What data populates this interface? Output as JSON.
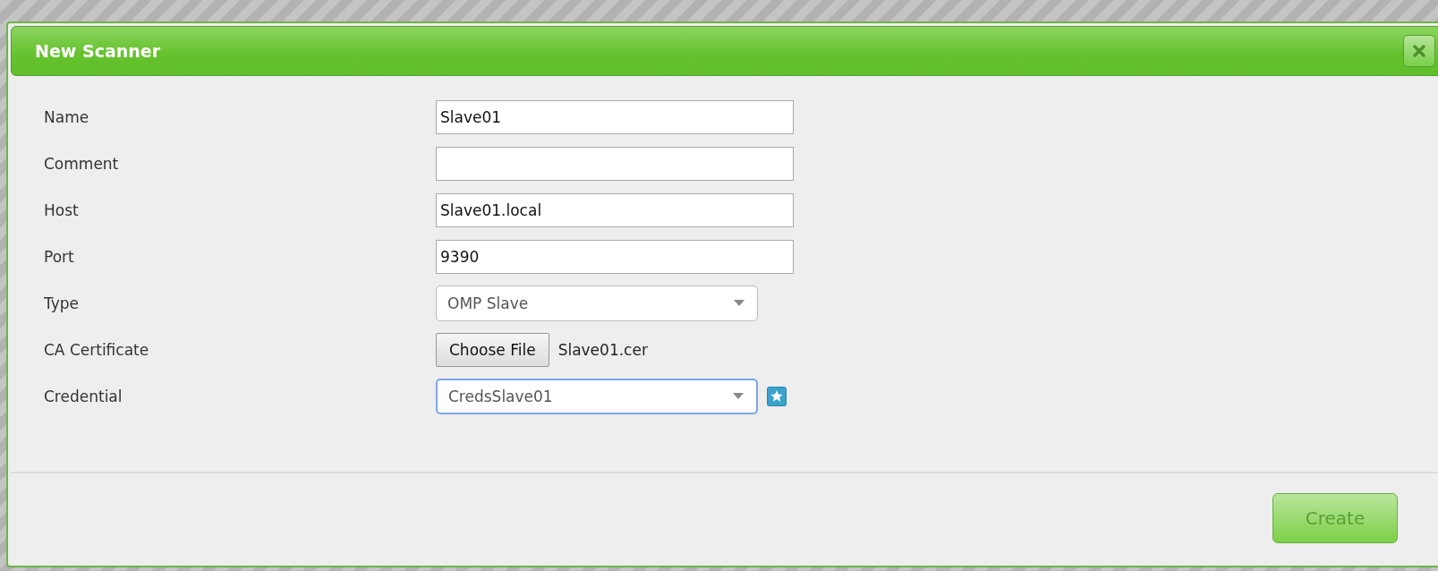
{
  "dialog": {
    "title": "New Scanner"
  },
  "fields": [
    {
      "label": "Name",
      "kind": "text",
      "value": "Slave01"
    },
    {
      "label": "Comment",
      "kind": "text"
    },
    {
      "label": "Host",
      "kind": "text",
      "value": "Slave01.local"
    },
    {
      "label": "Port",
      "kind": "text",
      "value": "9390"
    },
    {
      "label": "Type",
      "kind": "select",
      "value": "OMP Slave",
      "focused": false
    },
    {
      "label": "CA Certificate",
      "kind": "file",
      "button": "Choose File",
      "value": "Slave01.cer"
    },
    {
      "label": "Credential",
      "kind": "select",
      "value": "CredsSlave01",
      "focused": true,
      "add_button": true
    }
  ],
  "footer": {
    "button": "Create"
  }
}
